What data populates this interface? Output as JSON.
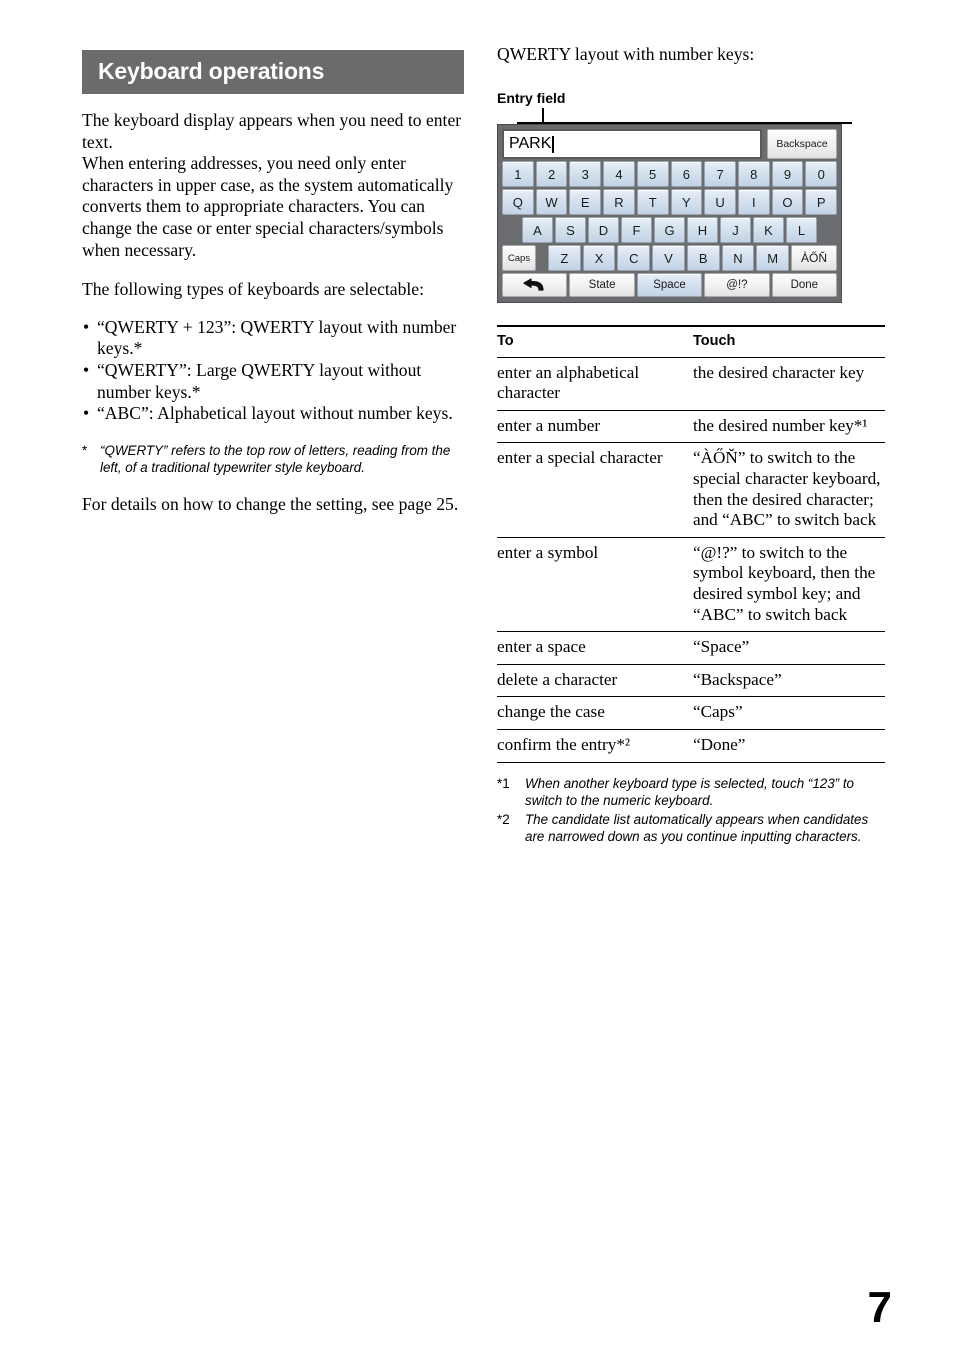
{
  "section": {
    "title": "Keyboard operations"
  },
  "left_column": {
    "intro_paragraph": "The keyboard display appears when you need to enter text.\nWhen entering addresses, you need only enter characters in upper case, as the system automatically converts them to appropriate characters. You can change the case or enter special characters/symbols when necessary.",
    "selectable_lead": "The following types of keyboards are selectable:",
    "keyboard_types": [
      "“QWERTY + 123”: QWERTY layout with number keys.*",
      "“QWERTY”: Large QWERTY layout without number keys.*",
      "“ABC”: Alphabetical layout without number keys."
    ],
    "footnote_mark": "*",
    "footnote_text": "“QWERTY” refers to the top row of letters, reading from the left, of a traditional typewriter style keyboard.",
    "closing_paragraph": "For details on how to change the setting, see page 25."
  },
  "right_column": {
    "heading": "QWERTY layout with number keys:",
    "entry_field_label": "Entry field"
  },
  "keyboard": {
    "entry_value": "PARK",
    "backspace_label": "Backspace",
    "number_row": [
      "1",
      "2",
      "3",
      "4",
      "5",
      "6",
      "7",
      "8",
      "9",
      "0"
    ],
    "row_qwerty": [
      "Q",
      "W",
      "E",
      "R",
      "T",
      "Y",
      "U",
      "I",
      "O",
      "P"
    ],
    "row_asdf": [
      "A",
      "S",
      "D",
      "F",
      "G",
      "H",
      "J",
      "K",
      "L"
    ],
    "caps_label": "Caps",
    "row_zxcv": [
      "Z",
      "X",
      "C",
      "V",
      "B",
      "N",
      "M"
    ],
    "accent_label": "ÀŐŇ",
    "function_row": {
      "back_icon": "back-arrow-icon",
      "state_label": "State",
      "space_label": "Space",
      "symbol_label": "@!?",
      "done_label": "Done"
    },
    "colors": {
      "frame": "#6a6c70",
      "key_blue": "#d3e0ee",
      "key_white": "#f0f0f0"
    }
  },
  "table": {
    "headers": [
      "To",
      "Touch"
    ],
    "rows": [
      {
        "to": "enter an alphabetical character",
        "touch": "the desired character key"
      },
      {
        "to": "enter a number",
        "touch": "the desired number key*¹"
      },
      {
        "to": "enter a special character",
        "touch": "“ÀŐŇ” to switch to the special character keyboard, then the desired character; and “ABC” to switch back"
      },
      {
        "to": "enter a symbol",
        "touch": "“@!?” to switch to the symbol keyboard, then the desired symbol key; and “ABC” to switch back"
      },
      {
        "to": "enter a space",
        "touch": "“Space”"
      },
      {
        "to": "delete a character",
        "touch": "“Backspace”"
      },
      {
        "to": "change the case",
        "touch": "“Caps”"
      },
      {
        "to": "confirm the entry*²",
        "touch": "“Done”"
      }
    ],
    "footnotes": [
      {
        "mark": "*1",
        "text": "When another keyboard type is selected, touch “123” to switch to the numeric keyboard."
      },
      {
        "mark": "*2",
        "text": "The candidate list automatically appears when candidates are narrowed down as you continue inputting characters."
      }
    ]
  },
  "page_number": "7"
}
